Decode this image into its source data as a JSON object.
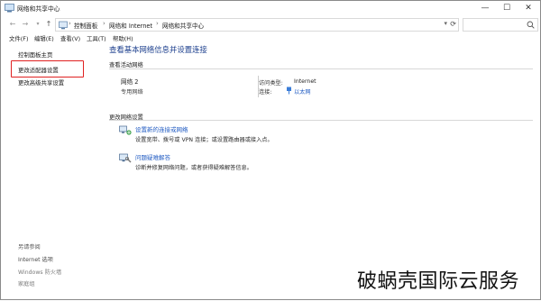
{
  "window": {
    "title": "网络和共享中心",
    "minimize_symbol": "—",
    "maximize_symbol": "☐",
    "close_symbol": "✕"
  },
  "address_bar": {
    "breadcrumbs": [
      "控制面板",
      "网络和 Internet",
      "网络和共享中心"
    ],
    "separator": "›",
    "nav_back": "←",
    "nav_forward": "→",
    "nav_recent": "▾",
    "nav_up": "↑",
    "dropdown": "▾",
    "refresh": "⟳",
    "search_placeholder": ""
  },
  "menu": [
    "文件(F)",
    "编辑(E)",
    "查看(V)",
    "工具(T)",
    "帮助(H)"
  ],
  "sidebar": {
    "home_link": "控制面板主页",
    "adapter_link": "更改适配器设置",
    "sharing_link": "更改高级共享设置",
    "see_also_heading": "另请参阅",
    "see_also": [
      "Internet 选项",
      "Windows 防火墙",
      "家庭组"
    ]
  },
  "main": {
    "page_title": "查看基本网络信息并设置连接",
    "active_heading": "查看活动网络",
    "network_name": "网络 2",
    "network_type": "专用网络",
    "access_type_label": "访问类型:",
    "access_type_value": "Internet",
    "connections_label": "连接:",
    "connections_value": "以太网",
    "change_heading": "更改网络设置",
    "tasks": [
      {
        "link": "设置新的连接或网络",
        "desc": "设置宽带、拨号或 VPN 连接；或设置路由器或接入点。",
        "icon": "network-setup-icon"
      },
      {
        "link": "问题疑难解答",
        "desc": "诊断并修复网络问题，或者获得疑难解答信息。",
        "icon": "troubleshoot-icon"
      }
    ]
  },
  "watermark": "破蜗壳国际云服务",
  "colors": {
    "link": "#1f5ac2",
    "title": "#1a3d8c",
    "highlight": "#e02020"
  }
}
